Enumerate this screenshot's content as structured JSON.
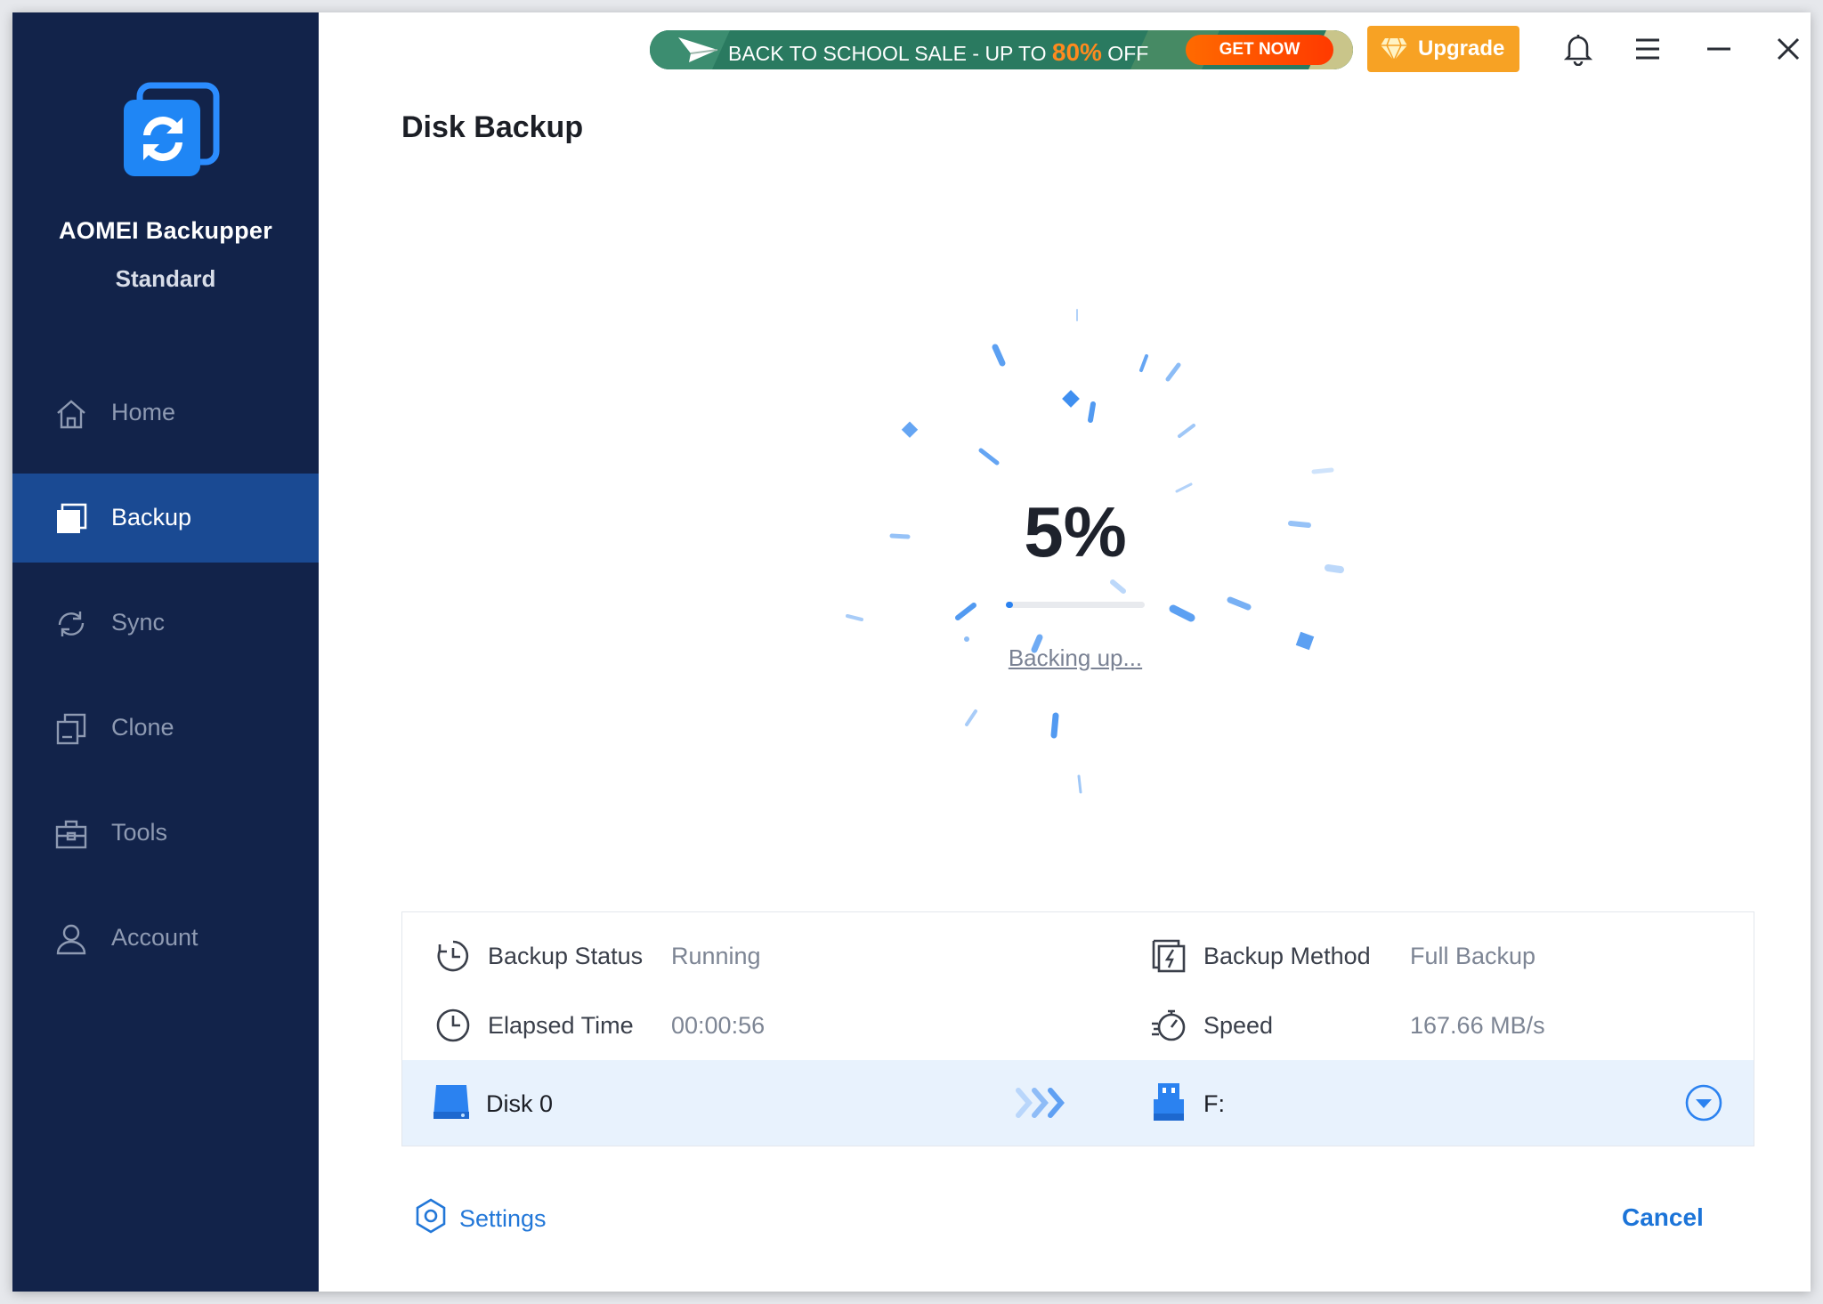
{
  "app": {
    "name": "AOMEI Backupper",
    "edition": "Standard"
  },
  "sidebar": {
    "items": [
      {
        "label": "Home",
        "icon": "home-icon"
      },
      {
        "label": "Backup",
        "icon": "backup-icon",
        "active": true
      },
      {
        "label": "Sync",
        "icon": "sync-icon"
      },
      {
        "label": "Clone",
        "icon": "clone-icon"
      },
      {
        "label": "Tools",
        "icon": "tools-icon"
      },
      {
        "label": "Account",
        "icon": "account-icon"
      }
    ]
  },
  "topbar": {
    "promo": {
      "text_before": "BACK TO SCHOOL SALE - UP TO ",
      "highlight": "80%",
      "text_after": " OFF",
      "button": "GET NOW"
    },
    "upgrade_label": "Upgrade"
  },
  "page": {
    "title": "Disk Backup"
  },
  "progress": {
    "percent_text": "5%",
    "fraction": 0.05,
    "status_text": "Backing up..."
  },
  "info": {
    "backup_status": {
      "label": "Backup Status",
      "value": "Running"
    },
    "elapsed_time": {
      "label": "Elapsed Time",
      "value": "00:00:56"
    },
    "backup_method": {
      "label": "Backup Method",
      "value": "Full Backup"
    },
    "speed": {
      "label": "Speed",
      "value": "167.66 MB/s"
    }
  },
  "transfer": {
    "source": "Disk 0",
    "destination": "F:"
  },
  "footer": {
    "settings_label": "Settings",
    "cancel_label": "Cancel"
  },
  "colors": {
    "sidebar_bg": "#12234a",
    "sidebar_active": "#1a4a93",
    "accent_blue": "#2b82f0",
    "upgrade_orange": "#f7a224",
    "promo_green": "#1f6c56"
  }
}
